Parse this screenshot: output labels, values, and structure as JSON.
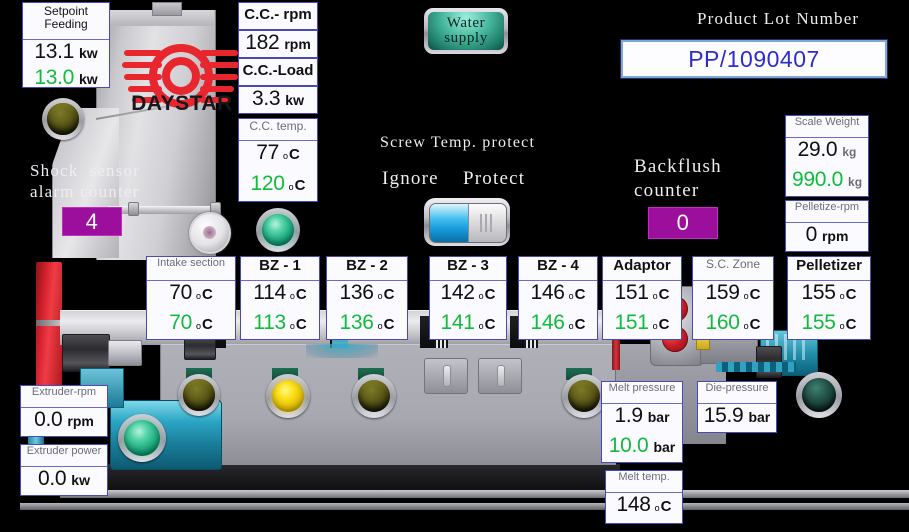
{
  "brand": {
    "name": "DAYSTAR"
  },
  "header": {
    "lot_label": "Product Lot Number",
    "lot_value": "PP/1090407"
  },
  "buttons": {
    "water_supply_line1": "Water",
    "water_supply_line2": "supply"
  },
  "screw_protect": {
    "title": "Screw Temp. protect",
    "option_left": "Ignore",
    "option_right": "Protect",
    "selected": "Ignore"
  },
  "counters": {
    "shock_label_line1": "Shock  sensor",
    "shock_label_line2": "alarm counter",
    "shock_value": "4",
    "backflush_label_line1": "Backflush",
    "backflush_label_line2": "counter",
    "backflush_value": "0",
    "color": "#9c0f9c"
  },
  "panels": {
    "setpoint_feeding": {
      "title_line1": "Setpoint",
      "title_line2": "Feeding",
      "actual": "13.1",
      "actual_unit": "kw",
      "setpoint": "13.0",
      "setpoint_unit": "kw"
    },
    "cc_rpm": {
      "title": "C.C.- rpm",
      "value": "182",
      "unit": "rpm"
    },
    "cc_load": {
      "title": "C.C.-Load",
      "value": "3.3",
      "unit": "kw"
    },
    "cc_temp": {
      "title": "C.C. temp.",
      "actual": "77",
      "setpoint": "120",
      "unit": "°C"
    },
    "scale_weight": {
      "title": "Scale Weight",
      "actual": "29.0",
      "actual_unit": "kg",
      "setpoint": "990.0",
      "setpoint_unit": "kg"
    },
    "pelletize_rpm": {
      "title": "Pelletize-rpm",
      "value": "0",
      "unit": "rpm"
    },
    "extruder_rpm": {
      "title": "Extruder-rpm",
      "value": "0.0",
      "unit": "rpm"
    },
    "extruder_power": {
      "title": "Extruder power",
      "value": "0.0",
      "unit": "kw"
    },
    "melt_pressure": {
      "title": "Melt pressure",
      "actual": "1.9",
      "actual_unit": "bar",
      "setpoint": "10.0",
      "setpoint_unit": "bar"
    },
    "die_pressure": {
      "title": "Die-pressure",
      "value": "15.9",
      "unit": "bar"
    },
    "melt_temp": {
      "title": "Melt temp.",
      "value": "148",
      "unit": "°C"
    }
  },
  "temperature_zones": [
    {
      "name": "Intake section",
      "actual": "70",
      "setpoint": "70",
      "unit": "°C",
      "title_style": "grey"
    },
    {
      "name": "BZ - 1",
      "actual": "114",
      "setpoint": "113",
      "unit": "°C",
      "title_style": "dark"
    },
    {
      "name": "BZ - 2",
      "actual": "136",
      "setpoint": "136",
      "unit": "°C",
      "title_style": "dark"
    },
    {
      "name": "BZ - 3",
      "actual": "142",
      "setpoint": "141",
      "unit": "°C",
      "title_style": "dark"
    },
    {
      "name": "BZ - 4",
      "actual": "146",
      "setpoint": "146",
      "unit": "°C",
      "title_style": "dark"
    },
    {
      "name": "Adaptor",
      "actual": "151",
      "setpoint": "151",
      "unit": "°C",
      "title_style": "dark"
    },
    {
      "name": "S.C. Zone",
      "actual": "159",
      "setpoint": "160",
      "unit": "°C",
      "title_style": "grey"
    },
    {
      "name": "Pelletizer",
      "actual": "155",
      "setpoint": "155",
      "unit": "°C",
      "title_style": "dark"
    }
  ],
  "lamps": [
    {
      "name": "feeder-lamp",
      "state": "olive"
    },
    {
      "name": "cc-lamp",
      "state": "green"
    },
    {
      "name": "intake-lamp",
      "state": "olive-dk"
    },
    {
      "name": "extruder-lamp",
      "state": "green"
    },
    {
      "name": "bz1-lamp",
      "state": "yellow"
    },
    {
      "name": "bz2-lamp",
      "state": "olive-dk"
    },
    {
      "name": "bz4-lamp",
      "state": "olive-dk"
    },
    {
      "name": "pelletizer-lamp",
      "state": "teal-dark"
    }
  ],
  "colors": {
    "background": "#000000",
    "actual_text": "#101010",
    "setpoint_text": "#0fbc3b",
    "panel_bg": "#fbfbff",
    "panel_border": "#4a4ab4",
    "lot_text": "#2c2ccf",
    "counter_bg": "#9c0f9c",
    "logo_red": "#e8262e"
  }
}
